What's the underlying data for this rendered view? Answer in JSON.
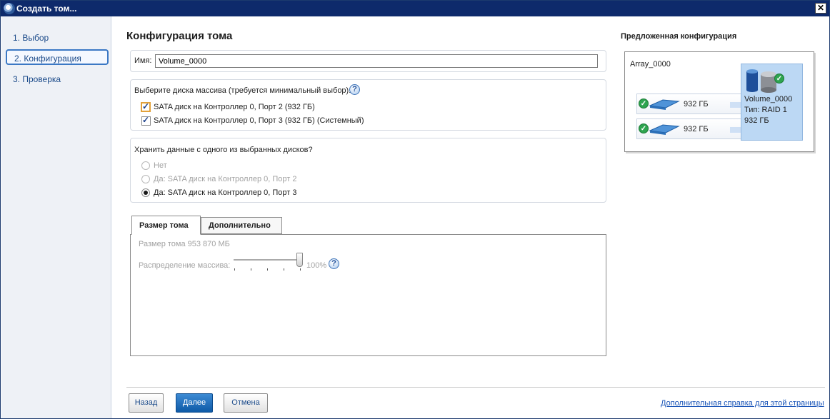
{
  "window": {
    "title": "Создать том...",
    "close_glyph": "✕"
  },
  "sidebar": {
    "items": [
      {
        "label": "1. Выбор",
        "active": false
      },
      {
        "label": "2. Конфигурация",
        "active": true
      },
      {
        "label": "3. Проверка",
        "active": false
      }
    ]
  },
  "main": {
    "title": "Конфигурация тома",
    "name_label": "Имя:",
    "name_value": "Volume_0000",
    "disks": {
      "heading": "Выберите диска массива (требуется минимальный выбор):",
      "items": [
        {
          "label": "SATA диск на Контроллер 0, Порт 2 (932 ГБ)",
          "checked": true
        },
        {
          "label": "SATA диск на Контроллер 0, Порт 3 (932 ГБ) (Системный)",
          "checked": true
        }
      ]
    },
    "keep_data": {
      "heading": "Хранить данные с одного из выбранных дисков?",
      "options": [
        {
          "label": "Нет",
          "selected": false,
          "disabled": true
        },
        {
          "label": "Да: SATA диск на Контроллер 0, Порт 2",
          "selected": false,
          "disabled": true
        },
        {
          "label": "Да: SATA диск на Контроллер 0, Порт 3",
          "selected": true,
          "disabled": false
        }
      ]
    },
    "tabs": [
      {
        "label": "Размер тома",
        "active": true
      },
      {
        "label": "Дополнительно",
        "active": false
      }
    ],
    "size_panel": {
      "size_text": "Размер тома 953 870 МБ",
      "distribution_label": "Распределение массива:",
      "distribution_value": "100%",
      "slider_fraction": 1.0
    }
  },
  "buttons": {
    "back": "Назад",
    "next": "Далее",
    "cancel": "Отмена"
  },
  "help_link": "Дополнительная справка для этой страницы",
  "proposed": {
    "title": "Предложенная конфигурация",
    "array_name": "Array_0000",
    "disks": [
      {
        "size": "932 ГБ"
      },
      {
        "size": "932 ГБ"
      }
    ],
    "volume": {
      "name": "Volume_0000",
      "type": "Тип: RAID 1",
      "size": "932 ГБ"
    }
  },
  "icons": {
    "app": "raid-app-icon",
    "help": "help-question-icon",
    "check": "green-check-icon",
    "disk": "hard-disk-icon",
    "volume": "volume-cylinders-icon"
  },
  "colors": {
    "titlebar": "#0e2a6b",
    "accent": "#3b78c4",
    "primary_button": "#1a6bc0",
    "link": "#1a55b8"
  }
}
